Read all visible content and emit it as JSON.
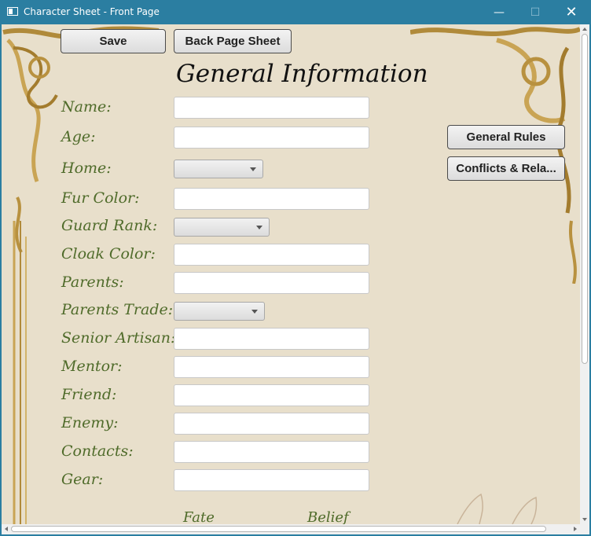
{
  "window": {
    "title": "Character Sheet - Front Page"
  },
  "toolbar": {
    "save_label": "Save",
    "back_label": "Back Page Sheet"
  },
  "heading": "General Information",
  "side_buttons": {
    "rules": "General Rules",
    "conflicts": "Conflicts & Rela..."
  },
  "fields": {
    "name": {
      "label": "Name:",
      "value": ""
    },
    "age": {
      "label": "Age:",
      "value": ""
    },
    "home": {
      "label": "Home:",
      "value": ""
    },
    "fur_color": {
      "label": "Fur Color:",
      "value": ""
    },
    "guard_rank": {
      "label": "Guard Rank:",
      "value": ""
    },
    "cloak_color": {
      "label": "Cloak Color:",
      "value": ""
    },
    "parents": {
      "label": "Parents:",
      "value": ""
    },
    "parents_trade": {
      "label": "Parents Trade:",
      "value": ""
    },
    "senior_artisan": {
      "label": "Senior Artisan:",
      "value": ""
    },
    "mentor": {
      "label": "Mentor:",
      "value": ""
    },
    "friend": {
      "label": "Friend:",
      "value": ""
    },
    "enemy": {
      "label": "Enemy:",
      "value": ""
    },
    "contacts": {
      "label": "Contacts:",
      "value": ""
    },
    "gear": {
      "label": "Gear:",
      "value": ""
    }
  },
  "footer": {
    "fate": "Fate",
    "belief": "Belief"
  },
  "colors": {
    "titlebar": "#2b7ea1",
    "parchment": "#e8dfcb",
    "label_green": "#4f6b2a",
    "gold": "#b08a3a"
  },
  "icons": {
    "app": "window-icon",
    "minimize": "minimize-icon",
    "maximize": "maximize-icon",
    "close": "close-icon"
  }
}
